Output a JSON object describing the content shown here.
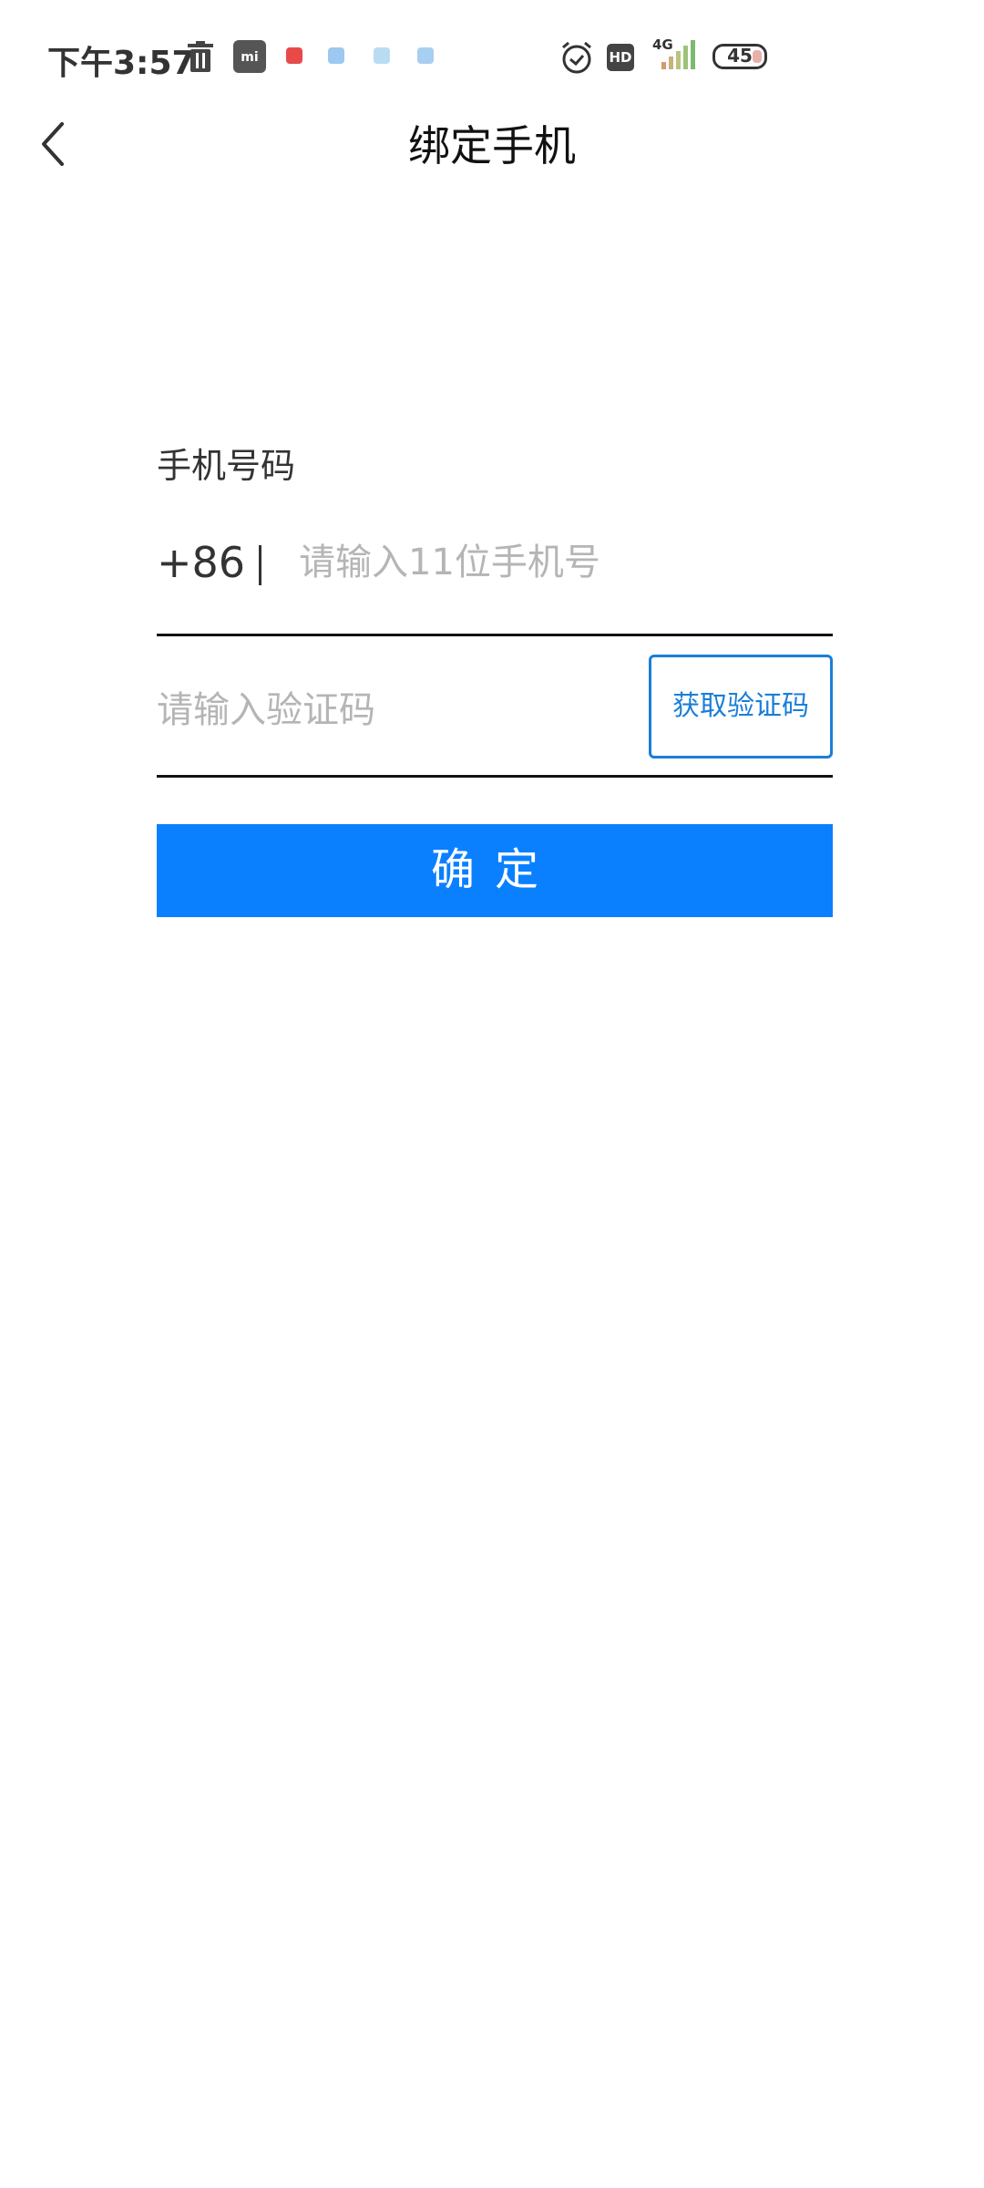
{
  "status_bar": {
    "time": "下午3:57",
    "hd_label": "HD",
    "network_label": "4G",
    "battery": "45",
    "icons": [
      "trash-icon",
      "mi-store-icon",
      "app-notification-icon",
      "alarm-icon",
      "hd-icon",
      "signal-icon",
      "battery-icon"
    ]
  },
  "header": {
    "title": "绑定手机",
    "back_icon": "chevron-left-icon"
  },
  "form": {
    "phone_label": "手机号码",
    "country_code": "+86",
    "phone_placeholder": "请输入11位手机号",
    "phone_value": "",
    "code_placeholder": "请输入验证码",
    "code_value": "",
    "get_code_label": "获取验证码",
    "confirm_label": "确定"
  },
  "colors": {
    "accent": "#0a80ff",
    "link": "#1a7ed8",
    "placeholder": "#b5b5b5"
  }
}
